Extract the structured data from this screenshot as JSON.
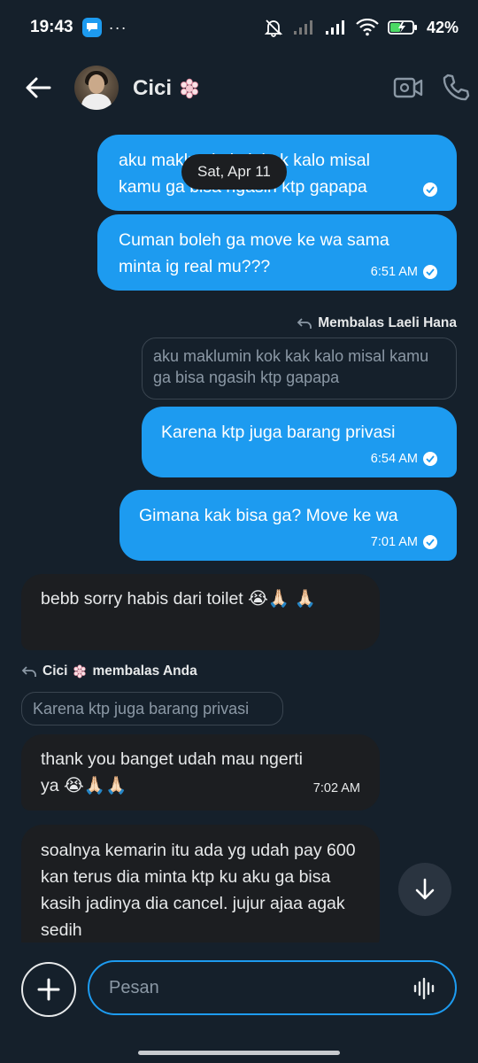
{
  "status_bar": {
    "time": "19:43",
    "dots": "···",
    "battery_text": "42%"
  },
  "header": {
    "contact_name": "Cici"
  },
  "chat": {
    "date_separator": "Sat, Apr 11",
    "messages": [
      {
        "text": "aku maklumin kok kak kalo misal kamu ga bisa ngasih ktp gapapa",
        "time": ""
      },
      {
        "text": "Cuman boleh ga move ke wa sama minta ig real mu???",
        "time": "6:51 AM"
      },
      {
        "reply_note": "Membalas Laeli Hana",
        "quote": "aku maklumin kok kak kalo misal kamu ga bisa ngasih ktp gapapa"
      },
      {
        "text": "Karena ktp juga barang privasi",
        "time": "6:54 AM"
      },
      {
        "text": "Gimana kak bisa ga? Move ke wa",
        "time": "7:01 AM"
      },
      {
        "text": "bebb sorry habis dari toilet 😭🙏🏻 🙏🏻"
      },
      {
        "reply_note_name": "Cici",
        "reply_note_rest": "membalas Anda",
        "quote": "Karena ktp juga barang privasi"
      },
      {
        "text": "thank you banget udah mau ngerti ya 😭🙏🏻🙏🏻",
        "time": "7:02 AM"
      },
      {
        "text": "soalnya kemarin itu ada yg udah pay 600 kan terus dia minta ktp ku aku ga bisa kasih jadinya dia cancel. jujur ajaa agak sedih"
      }
    ]
  },
  "composer": {
    "placeholder": "Pesan"
  },
  "colors": {
    "background": "#15202b",
    "accent": "#1d9bf0",
    "incoming_bubble": "#1c1e21"
  },
  "icons": [
    "back-arrow-icon",
    "flower-emoji-icon",
    "video-call-icon",
    "phone-call-icon",
    "reply-arrow-icon",
    "double-check-icon",
    "scroll-down-icon",
    "plus-icon",
    "voice-wave-icon"
  ]
}
